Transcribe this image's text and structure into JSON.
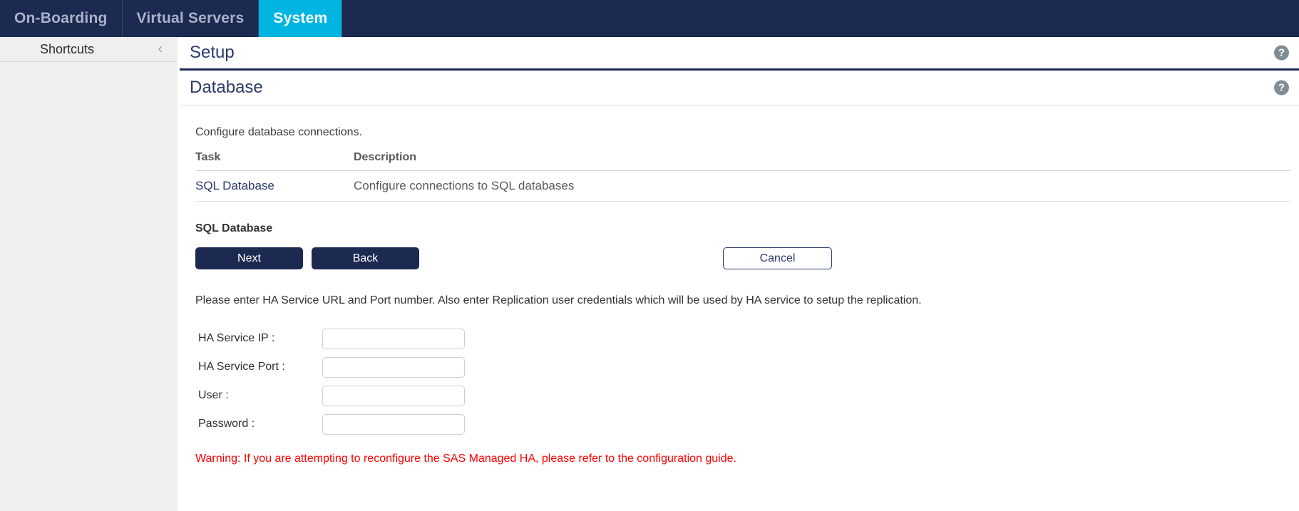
{
  "topnav": {
    "tabs": [
      {
        "label": "On-Boarding",
        "active": false
      },
      {
        "label": "Virtual Servers",
        "active": false
      },
      {
        "label": "System",
        "active": true
      }
    ],
    "active_color": "#00b5e2",
    "background_color": "#1c2a52"
  },
  "sidebar": {
    "title": "Shortcuts",
    "collapse_icon": "‹",
    "background_color": "#efefef"
  },
  "page": {
    "title": "Setup",
    "help_icon": "?",
    "section_title": "Database",
    "intro": "Configure database connections."
  },
  "task_table": {
    "columns": [
      "Task",
      "Description"
    ],
    "rows": [
      {
        "task": "SQL Database",
        "description": "Configure connections to SQL databases"
      }
    ]
  },
  "subsection": {
    "title": "SQL Database",
    "buttons": {
      "next": "Next",
      "back": "Back",
      "cancel": "Cancel"
    },
    "instruction": "Please enter HA Service URL and Port number. Also enter Replication user credentials which will be used by HA service to setup the replication.",
    "fields": [
      {
        "label": "HA Service IP :",
        "value": "",
        "placeholder": ""
      },
      {
        "label": "HA Service Port :",
        "value": "",
        "placeholder": ""
      },
      {
        "label": "User :",
        "value": "",
        "placeholder": ""
      },
      {
        "label": "Password :",
        "value": "",
        "placeholder": ""
      }
    ],
    "warning": "Warning: If you are attempting to reconfigure the SAS Managed HA, please refer to the configuration guide.",
    "warning_color": "#fe0000"
  }
}
